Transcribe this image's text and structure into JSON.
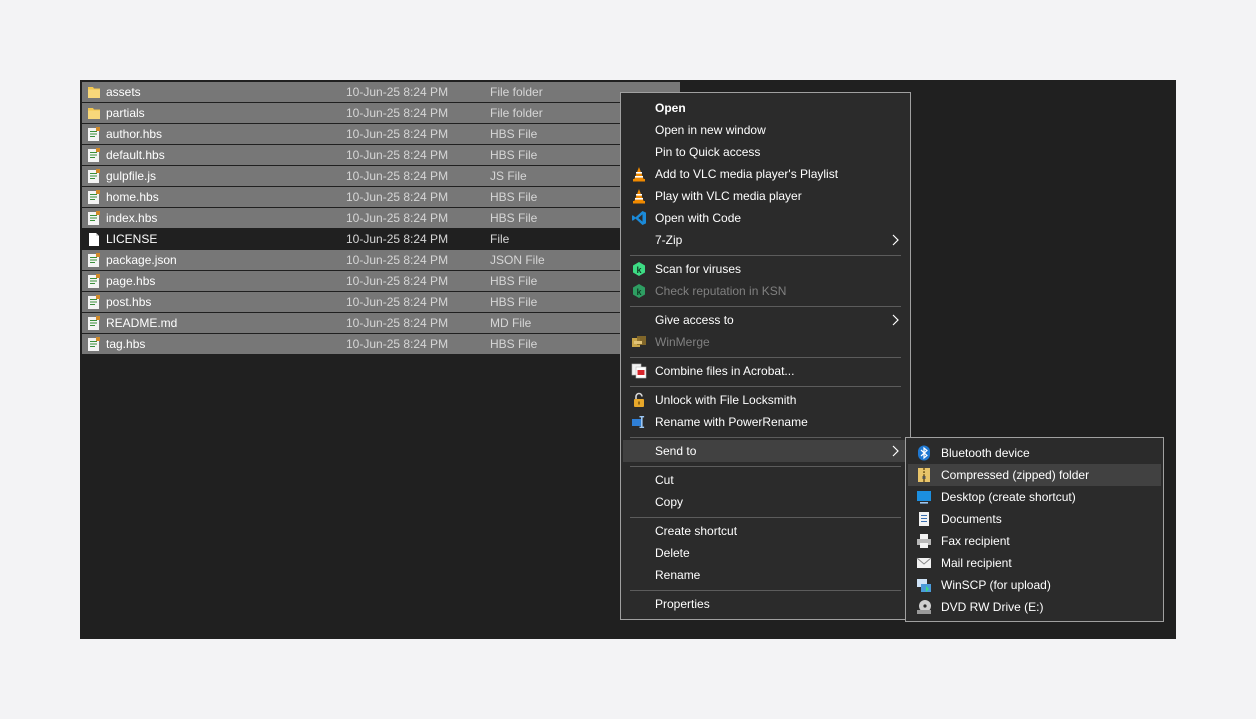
{
  "files": [
    {
      "name": "assets",
      "date": "10-Jun-25 8:24 PM",
      "type": "File folder",
      "icon": "folder-icon",
      "selected": true
    },
    {
      "name": "partials",
      "date": "10-Jun-25 8:24 PM",
      "type": "File folder",
      "icon": "folder-icon",
      "selected": true
    },
    {
      "name": "author.hbs",
      "date": "10-Jun-25 8:24 PM",
      "type": "HBS File",
      "icon": "text-file-icon",
      "selected": true
    },
    {
      "name": "default.hbs",
      "date": "10-Jun-25 8:24 PM",
      "type": "HBS File",
      "icon": "text-file-icon",
      "selected": true
    },
    {
      "name": "gulpfile.js",
      "date": "10-Jun-25 8:24 PM",
      "type": "JS File",
      "icon": "text-file-icon",
      "selected": true
    },
    {
      "name": "home.hbs",
      "date": "10-Jun-25 8:24 PM",
      "type": "HBS File",
      "icon": "text-file-icon",
      "selected": true
    },
    {
      "name": "index.hbs",
      "date": "10-Jun-25 8:24 PM",
      "type": "HBS File",
      "icon": "text-file-icon",
      "selected": true
    },
    {
      "name": "LICENSE",
      "date": "10-Jun-25 8:24 PM",
      "type": "File",
      "icon": "blank-file-icon",
      "selected": false
    },
    {
      "name": "package.json",
      "date": "10-Jun-25 8:24 PM",
      "type": "JSON File",
      "icon": "text-file-icon",
      "selected": true
    },
    {
      "name": "page.hbs",
      "date": "10-Jun-25 8:24 PM",
      "type": "HBS File",
      "icon": "text-file-icon",
      "selected": true
    },
    {
      "name": "post.hbs",
      "date": "10-Jun-25 8:24 PM",
      "type": "HBS File",
      "icon": "text-file-icon",
      "selected": true
    },
    {
      "name": "README.md",
      "date": "10-Jun-25 8:24 PM",
      "type": "MD File",
      "icon": "text-file-icon",
      "selected": true
    },
    {
      "name": "tag.hbs",
      "date": "10-Jun-25 8:24 PM",
      "type": "HBS File",
      "icon": "text-file-icon",
      "selected": true
    }
  ],
  "context_menu": {
    "open": "Open",
    "open_new_window": "Open in new window",
    "pin_quick_access": "Pin to Quick access",
    "vlc_add_playlist": "Add to VLC media player's Playlist",
    "vlc_play": "Play with VLC media player",
    "open_with_code": "Open with Code",
    "seven_zip": "7-Zip",
    "scan_viruses": "Scan for viruses",
    "check_reputation": "Check reputation in KSN",
    "give_access": "Give access to",
    "winmerge": "WinMerge",
    "combine_acrobat": "Combine files in Acrobat...",
    "unlock_locksmith": "Unlock with File Locksmith",
    "rename_powerrename": "Rename with PowerRename",
    "send_to": "Send to",
    "cut": "Cut",
    "copy": "Copy",
    "create_shortcut": "Create shortcut",
    "delete": "Delete",
    "rename": "Rename",
    "properties": "Properties"
  },
  "send_to_menu": {
    "bluetooth": "Bluetooth device",
    "compressed": "Compressed (zipped) folder",
    "desktop": "Desktop (create shortcut)",
    "documents": "Documents",
    "fax": "Fax recipient",
    "mail": "Mail recipient",
    "winscp": "WinSCP (for upload)",
    "dvd": "DVD RW Drive (E:)"
  },
  "colors": {
    "explorer_bg": "#202020",
    "selection": "#777777",
    "menu_bg": "#2b2b2b",
    "menu_highlight": "#414141",
    "disabled_text": "#808080"
  }
}
